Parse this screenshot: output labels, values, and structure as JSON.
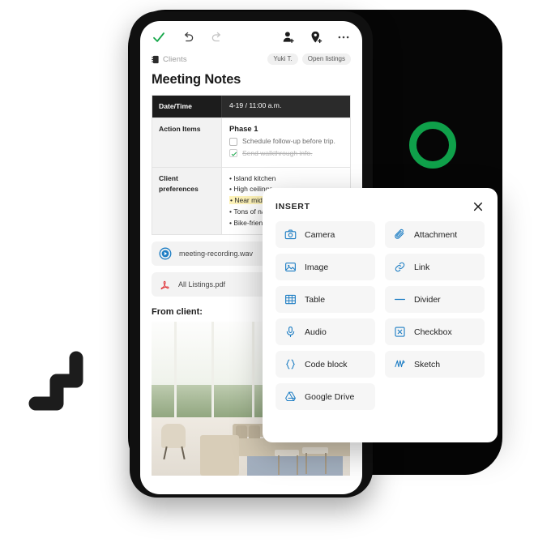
{
  "theme": {
    "accent_blue": "#1e7ec4",
    "accent_green": "#0fa04a",
    "panel_bg": "#ffffff",
    "item_bg": "#f6f6f6",
    "highlight_yellow": "#fdf2b8",
    "backdrop_black": "#060606"
  },
  "toolbar": {
    "done_label": "done-check",
    "undo_label": "undo",
    "redo_label": "redo",
    "add_person_label": "add-person",
    "add_location_label": "add-location",
    "more_label": "more-options"
  },
  "breadcrumb": {
    "icon": "notebook-icon",
    "label": "Clients",
    "chips": [
      "Yuki T.",
      "Open listings"
    ]
  },
  "document": {
    "title": "Meeting Notes",
    "table": {
      "header": {
        "label": "Date/Time",
        "value": "4-19 / 11:00 a.m."
      },
      "rows": [
        {
          "label": "Action Items",
          "phase": "Phase 1",
          "checklist": [
            {
              "text": "Schedule follow-up before trip.",
              "checked": false
            },
            {
              "text": "Send walkthrough info.",
              "checked": true
            }
          ]
        },
        {
          "label": "Client preferences",
          "bullets": [
            {
              "text": "Island kitchen",
              "highlight": false
            },
            {
              "text": "High ceilings",
              "highlight": false
            },
            {
              "text": "Near middle school",
              "highlight": true
            },
            {
              "text": "Tons of natural light",
              "highlight": false
            },
            {
              "text": "Bike-friendly streets",
              "highlight": false
            }
          ]
        }
      ]
    },
    "attachments": [
      {
        "name": "meeting-recording.wav",
        "icon": "play-circle-icon"
      },
      {
        "name": "All Listings.pdf",
        "icon": "pdf-icon"
      }
    ],
    "from_client_label": "From client:",
    "photo_alt": "living-room-photo"
  },
  "insert_panel": {
    "title": "INSERT",
    "close_label": "close-icon",
    "items": [
      {
        "label": "Camera",
        "icon": "camera-icon"
      },
      {
        "label": "Attachment",
        "icon": "paperclip-icon"
      },
      {
        "label": "Image",
        "icon": "image-icon"
      },
      {
        "label": "Link",
        "icon": "link-icon"
      },
      {
        "label": "Table",
        "icon": "table-icon"
      },
      {
        "label": "Divider",
        "icon": "divider-icon"
      },
      {
        "label": "Audio",
        "icon": "microphone-icon"
      },
      {
        "label": "Checkbox",
        "icon": "checkbox-icon"
      },
      {
        "label": "Code block",
        "icon": "code-braces-icon"
      },
      {
        "label": "Sketch",
        "icon": "sketch-icon"
      },
      {
        "label": "Google Drive",
        "icon": "google-drive-icon"
      }
    ]
  },
  "decorations": {
    "ring_label": "green-ring-decoration",
    "zigzag_label": "zigzag-decoration"
  }
}
